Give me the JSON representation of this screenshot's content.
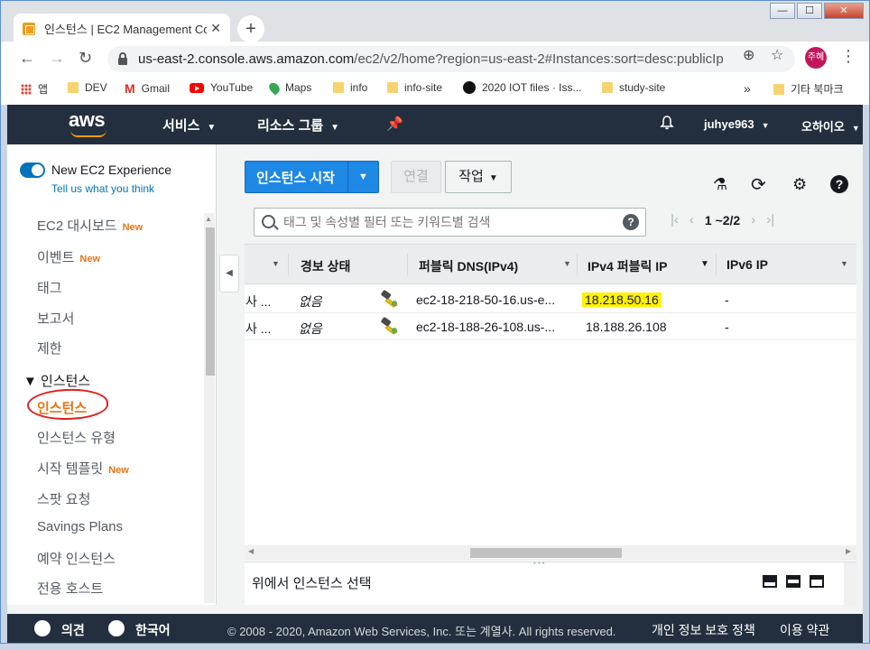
{
  "browser": {
    "tab_title": "인스턴스 | EC2 Management Co",
    "tab_close": "✕",
    "new_tab": "+",
    "window": {
      "minimize": "—",
      "maximize": "☐",
      "close": "✕"
    },
    "url_host": "us-east-2.console.aws.amazon.com",
    "url_path": "/ec2/v2/home?region=us-east-2#Instances:sort=desc:publicIp",
    "profile_initials": "주혜",
    "bookmarks": [
      {
        "label": "앱",
        "icon": "apps-grid-icon"
      },
      {
        "label": "DEV",
        "icon": "folder-icon"
      },
      {
        "label": "Gmail",
        "icon": "gmail-icon"
      },
      {
        "label": "YouTube",
        "icon": "youtube-icon"
      },
      {
        "label": "Maps",
        "icon": "maps-icon"
      },
      {
        "label": "info",
        "icon": "folder-icon"
      },
      {
        "label": "info-site",
        "icon": "folder-icon"
      },
      {
        "label": "2020 IOT files · Iss...",
        "icon": "github-icon"
      },
      {
        "label": "study-site",
        "icon": "folder-icon"
      }
    ],
    "bookmarks_overflow": "»",
    "other_bookmarks": "기타 북마크"
  },
  "aws_header": {
    "logo": "aws",
    "services": "서비스",
    "resource_groups": "리소스 그룹",
    "username": "juhye963",
    "region": "오하이오"
  },
  "sidebar": {
    "new_experience": "New EC2 Experience",
    "tell_us": "Tell us what you think",
    "new_badge": "New",
    "items": [
      {
        "label": "EC2 대시보드",
        "new": true
      },
      {
        "label": "이벤트",
        "new": true
      },
      {
        "label": "태그",
        "new": false
      },
      {
        "label": "보고서",
        "new": false
      },
      {
        "label": "제한",
        "new": false
      }
    ],
    "group": "▼ 인스턴스",
    "group_items": [
      {
        "label": "인스턴스",
        "active": true,
        "new": false
      },
      {
        "label": "인스턴스 유형",
        "active": false,
        "new": false
      },
      {
        "label": "시작 템플릿",
        "active": false,
        "new": true
      },
      {
        "label": "스팟 요청",
        "active": false,
        "new": false
      },
      {
        "label": "Savings Plans",
        "active": false,
        "new": false
      },
      {
        "label": "예약 인스턴스",
        "active": false,
        "new": false
      },
      {
        "label": "전용 호스트",
        "active": false,
        "new": false
      }
    ]
  },
  "actions": {
    "launch": "인스턴스 시작",
    "connect": "연결",
    "actions": "작업"
  },
  "search": {
    "placeholder": "태그 및 속성별 필터 또는 키워드별 검색",
    "pager": "1 ~2/2"
  },
  "table": {
    "columns": [
      "경보 상태",
      "퍼블릭 DNS(IPv4)",
      "IPv4 퍼블릭 IP",
      "IPv6 IP"
    ],
    "rows": [
      {
        "state": "사 ...",
        "alarm": "없음",
        "dns": "ec2-18-218-50-16.us-e...",
        "ipv4": "18.218.50.16",
        "ipv6": "-"
      },
      {
        "state": "사 ...",
        "alarm": "없음",
        "dns": "ec2-18-188-26-108.us-...",
        "ipv4": "18.188.26.108",
        "ipv6": "-"
      }
    ]
  },
  "detail": {
    "placeholder": "위에서 인스턴스 선택"
  },
  "footer": {
    "feedback": "의견",
    "language": "한국어",
    "copyright": "© 2008 - 2020, Amazon Web Services, Inc. 또는 계열사. All rights reserved.",
    "privacy": "개인 정보 보호 정책",
    "terms": "이용 약관"
  },
  "colors": {
    "aws_navy": "#232f3e",
    "aws_orange": "#ec7211",
    "primary_blue": "#1e88e5",
    "highlight": "#fff200"
  }
}
